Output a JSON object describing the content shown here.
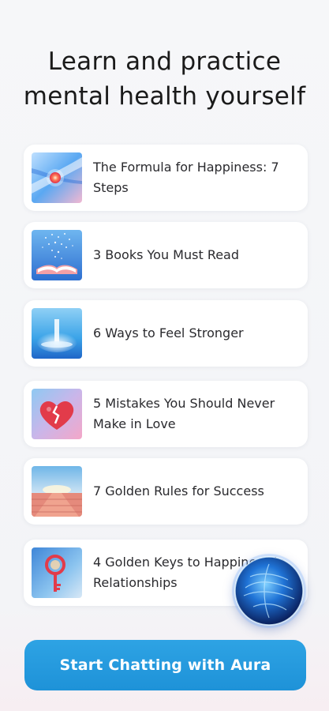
{
  "header": {
    "title_line1": "Learn and practice",
    "title_line2": "mental health yourself"
  },
  "articles": [
    {
      "label": "The Formula for Happiness: 7 Steps",
      "icon": "glowing-orb-image"
    },
    {
      "label": "3 Books You Must Read",
      "icon": "open-book-image"
    },
    {
      "label": "6 Ways to Feel Stronger",
      "icon": "light-fountain-image"
    },
    {
      "label": "5 Mistakes You Should Never Make in Love",
      "icon": "broken-heart-image"
    },
    {
      "label": "7 Golden Rules for Success",
      "icon": "golden-path-image"
    },
    {
      "label": "4 Golden Keys to Happiness in Relationships",
      "icon": "golden-key-image"
    }
  ],
  "assistant_orb": {
    "icon": "aura-orb-icon"
  },
  "cta": {
    "label": "Start Chatting with Aura"
  },
  "colors": {
    "accent": "#23a0e1",
    "card": "#ffffff",
    "background": "#f5f6f8"
  }
}
